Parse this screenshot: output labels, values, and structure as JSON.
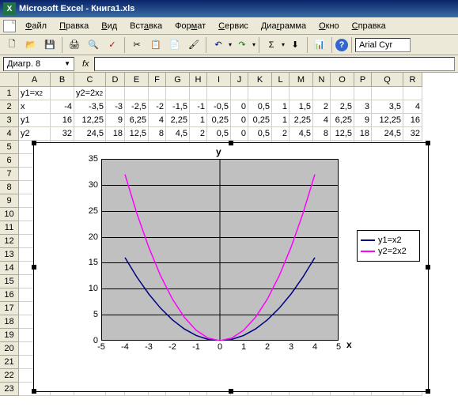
{
  "title": "Microsoft Excel - Книга1.xls",
  "menu": [
    "Файл",
    "Правка",
    "Вид",
    "Вставка",
    "Формат",
    "Сервис",
    "Диаграмма",
    "Окно",
    "Справка"
  ],
  "namebox": "Диагр. 8",
  "fx_label": "fx",
  "font": "Arial Cyr",
  "columns": [
    "A",
    "B",
    "C",
    "D",
    "E",
    "F",
    "G",
    "H",
    "I",
    "J",
    "K",
    "L",
    "M",
    "N",
    "O",
    "P",
    "Q",
    "R"
  ],
  "row_count": 23,
  "sheet": {
    "r1": {
      "A": "y1=x²",
      "C": "y2=2x²"
    },
    "r2": {
      "A": "x",
      "B": "-4",
      "C": "-3,5",
      "D": "-3",
      "E": "-2,5",
      "F": "-2",
      "G": "-1,5",
      "H": "-1",
      "I": "-0,5",
      "J": "0",
      "K": "0,5",
      "L": "1",
      "M": "1,5",
      "N": "2",
      "O": "2,5",
      "P": "3",
      "Q": "3,5",
      "R": "4"
    },
    "r3": {
      "A": "y1",
      "B": "16",
      "C": "12,25",
      "D": "9",
      "E": "6,25",
      "F": "4",
      "G": "2,25",
      "H": "1",
      "I": "0,25",
      "J": "0",
      "K": "0,25",
      "L": "1",
      "M": "2,25",
      "N": "4",
      "O": "6,25",
      "P": "9",
      "Q": "12,25",
      "R": "16"
    },
    "r4": {
      "A": "y2",
      "B": "32",
      "C": "24,5",
      "D": "18",
      "E": "12,5",
      "F": "8",
      "G": "4,5",
      "H": "2",
      "I": "0,5",
      "J": "0",
      "K": "0,5",
      "L": "2",
      "M": "4,5",
      "N": "8",
      "O": "12,5",
      "P": "18",
      "Q": "24,5",
      "R": "32"
    }
  },
  "chart": {
    "y_title": "y",
    "x_title": "x",
    "legend": [
      {
        "label": "y1=x2",
        "color": "#000080"
      },
      {
        "label": "y2=2x2",
        "color": "#ff00ff"
      }
    ],
    "y_ticks": [
      0,
      5,
      10,
      15,
      20,
      25,
      30,
      35
    ],
    "x_ticks": [
      -5,
      -4,
      -3,
      -2,
      -1,
      0,
      1,
      2,
      3,
      4,
      5
    ]
  },
  "chart_data": {
    "type": "line",
    "title": "",
    "xlabel": "x",
    "ylabel": "y",
    "x": [
      -4,
      -3.5,
      -3,
      -2.5,
      -2,
      -1.5,
      -1,
      -0.5,
      0,
      0.5,
      1,
      1.5,
      2,
      2.5,
      3,
      3.5,
      4
    ],
    "series": [
      {
        "name": "y1=x2",
        "color": "#000080",
        "values": [
          16,
          12.25,
          9,
          6.25,
          4,
          2.25,
          1,
          0.25,
          0,
          0.25,
          1,
          2.25,
          4,
          6.25,
          9,
          12.25,
          16
        ]
      },
      {
        "name": "y2=2x2",
        "color": "#ff00ff",
        "values": [
          32,
          24.5,
          18,
          12.5,
          8,
          4.5,
          2,
          0.5,
          0,
          0.5,
          2,
          4.5,
          8,
          12.5,
          18,
          24.5,
          32
        ]
      }
    ],
    "xlim": [
      -5,
      5
    ],
    "ylim": [
      0,
      35
    ]
  },
  "icons": {
    "new": "🗋",
    "open": "📂",
    "save": "💾",
    "print": "🖨",
    "preview": "🔍",
    "spell": "✓",
    "cut": "✂",
    "copy": "📋",
    "paste": "📄",
    "fmt": "🖌",
    "undo": "↶",
    "redo": "↷",
    "sum": "Σ",
    "sort": "⬇",
    "chart": "📊",
    "help": "?"
  }
}
